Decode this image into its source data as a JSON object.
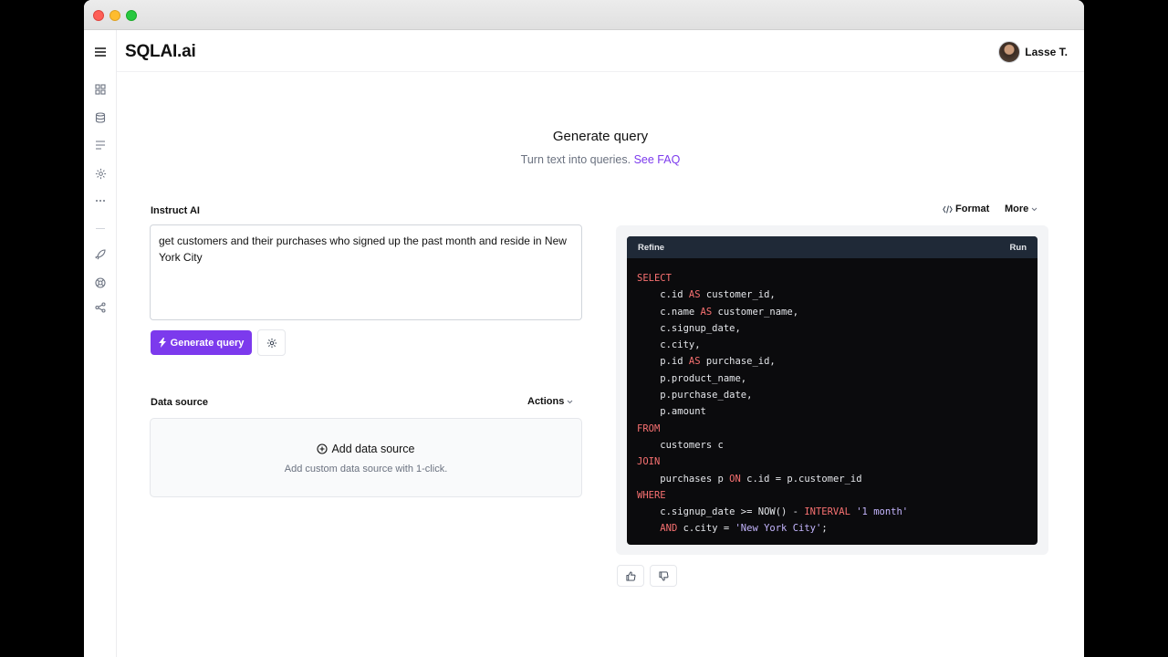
{
  "app": {
    "brand": "SQLAI.ai",
    "user_name": "Lasse T."
  },
  "sidebar": {
    "items": [
      {
        "icon": "dashboard-icon"
      },
      {
        "icon": "database-icon"
      },
      {
        "icon": "list-icon"
      },
      {
        "icon": "gear-icon"
      },
      {
        "icon": "more-icon"
      },
      {
        "icon": "rocket-icon"
      },
      {
        "icon": "help-icon"
      },
      {
        "icon": "share-icon"
      }
    ]
  },
  "hero": {
    "title": "Generate query",
    "subtitle": "Turn text into queries.",
    "faq_link": "See FAQ"
  },
  "instruct": {
    "label": "Instruct AI",
    "value": "get customers and their purchases who signed up the past month and reside in New York City",
    "generate_label": "Generate query"
  },
  "data_source": {
    "label": "Data source",
    "actions_label": "Actions",
    "add_label": "Add data source",
    "add_sub": "Add custom data source with 1-click."
  },
  "output": {
    "format_label": "Format",
    "more_label": "More",
    "refine_label": "Refine",
    "run_label": "Run",
    "sql_lines": [
      [
        {
          "t": "SELECT",
          "c": "kw"
        }
      ],
      [
        {
          "t": "    c.id "
        },
        {
          "t": "AS",
          "c": "kw"
        },
        {
          "t": " customer_id,"
        }
      ],
      [
        {
          "t": "    c.name "
        },
        {
          "t": "AS",
          "c": "kw"
        },
        {
          "t": " customer_name,"
        }
      ],
      [
        {
          "t": "    c.signup_date,"
        }
      ],
      [
        {
          "t": "    c.city,"
        }
      ],
      [
        {
          "t": "    p.id "
        },
        {
          "t": "AS",
          "c": "kw"
        },
        {
          "t": " purchase_id,"
        }
      ],
      [
        {
          "t": "    p.product_name,"
        }
      ],
      [
        {
          "t": "    p.purchase_date,"
        }
      ],
      [
        {
          "t": "    p.amount"
        }
      ],
      [
        {
          "t": "FROM",
          "c": "kw"
        }
      ],
      [
        {
          "t": "    customers c"
        }
      ],
      [
        {
          "t": "JOIN",
          "c": "kw"
        }
      ],
      [
        {
          "t": "    purchases p "
        },
        {
          "t": "ON",
          "c": "kw"
        },
        {
          "t": " c.id = p.customer_id"
        }
      ],
      [
        {
          "t": "WHERE",
          "c": "kw"
        }
      ],
      [
        {
          "t": "    c.signup_date >= NOW() - "
        },
        {
          "t": "INTERVAL",
          "c": "kw"
        },
        {
          "t": " "
        },
        {
          "t": "'1 month'",
          "c": "str"
        }
      ],
      [
        {
          "t": "    "
        },
        {
          "t": "AND",
          "c": "kw"
        },
        {
          "t": " c.city = "
        },
        {
          "t": "'New York City'",
          "c": "str"
        },
        {
          "t": ";"
        }
      ]
    ]
  }
}
